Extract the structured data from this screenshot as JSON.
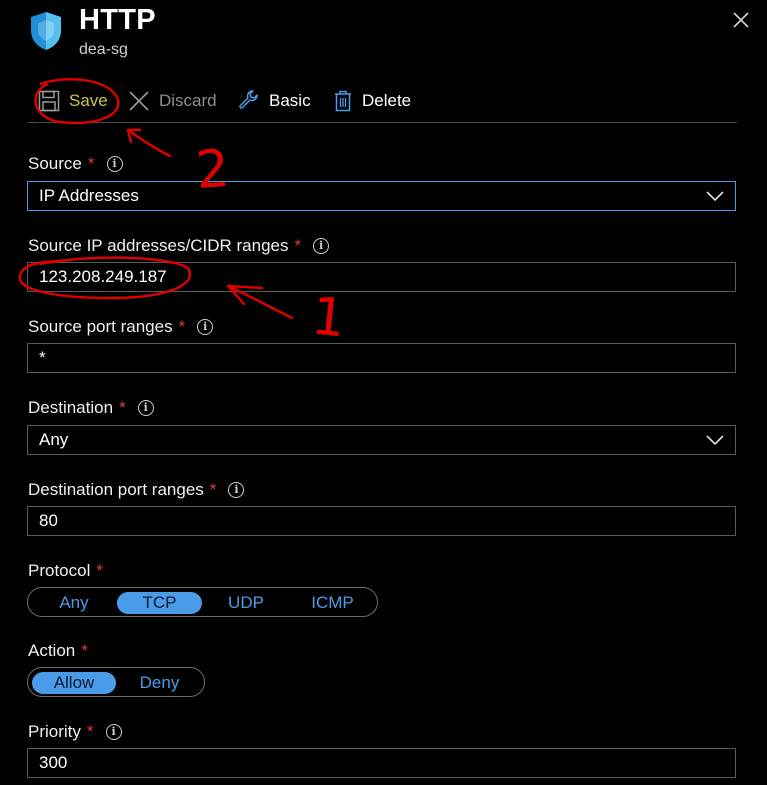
{
  "header": {
    "title": "HTTP",
    "subtitle": "dea-sg"
  },
  "toolbar": {
    "save": "Save",
    "discard": "Discard",
    "basic": "Basic",
    "delete": "Delete"
  },
  "form": {
    "source": {
      "label": "Source",
      "value": "IP Addresses"
    },
    "source_ip": {
      "label": "Source IP addresses/CIDR ranges",
      "value": "123.208.249.187"
    },
    "source_port": {
      "label": "Source port ranges",
      "value": "*"
    },
    "destination": {
      "label": "Destination",
      "value": "Any"
    },
    "dest_port": {
      "label": "Destination port ranges",
      "value": "80"
    },
    "protocol": {
      "label": "Protocol",
      "options": [
        "Any",
        "TCP",
        "UDP",
        "ICMP"
      ],
      "selected": "TCP"
    },
    "action": {
      "label": "Action",
      "options": [
        "Allow",
        "Deny"
      ],
      "selected": "Allow"
    },
    "priority": {
      "label": "Priority",
      "value": "300"
    }
  },
  "annotations": {
    "step1": "1",
    "step2": "2"
  },
  "colors": {
    "accent": "#4a9be8",
    "required": "#e23a3a",
    "annotation": "#e00000",
    "save": "#c8c84a"
  }
}
